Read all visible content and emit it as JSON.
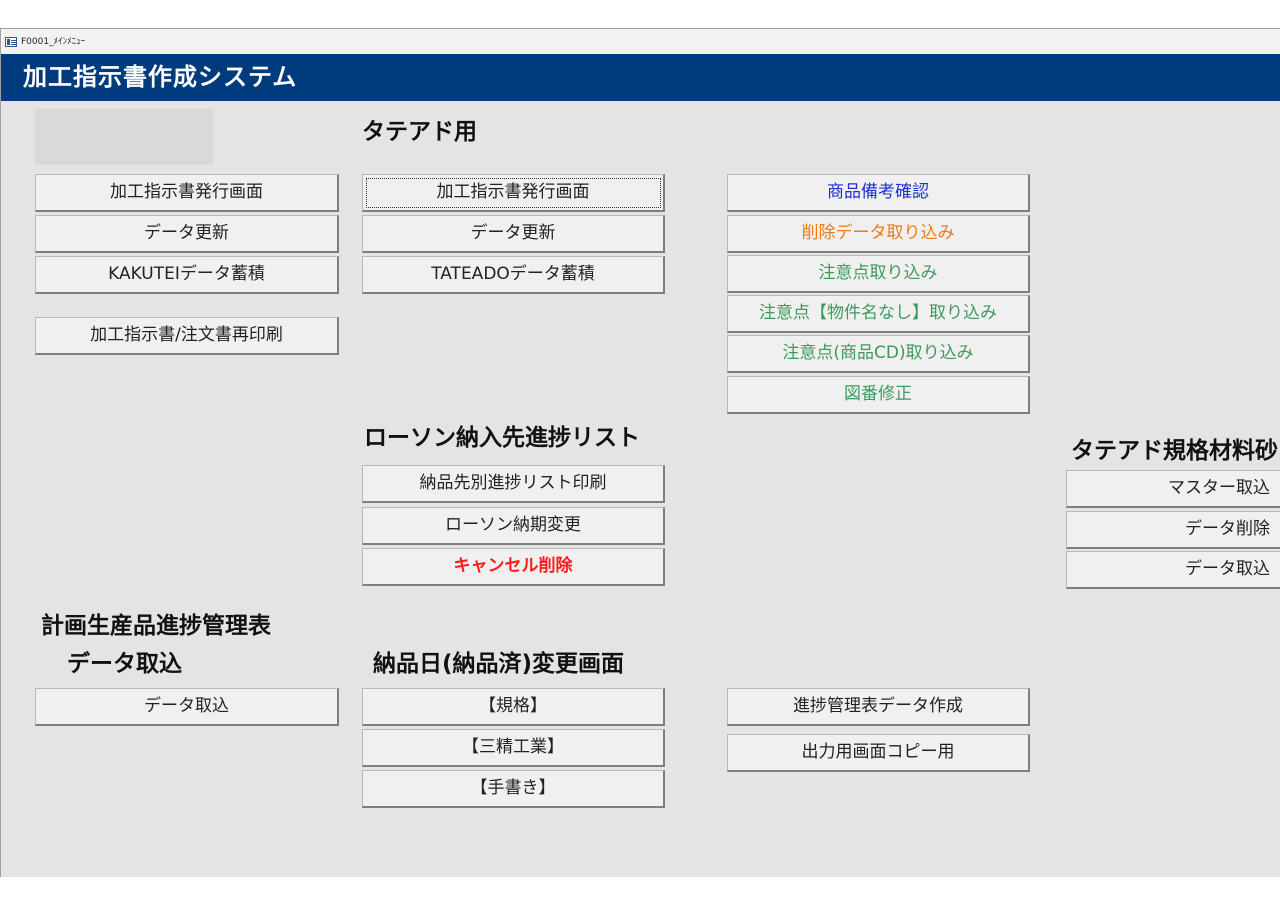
{
  "window": {
    "form_title": "F0001_ﾒｲﾝﾒﾆｭｰ",
    "icon": "form-icon"
  },
  "header": {
    "title": "加工指示書作成システム",
    "background": "#003b7d"
  },
  "section_general": {
    "buttons": [
      "加工指示書発行画面",
      "データ更新",
      "KAKUTEIデータ蓄積",
      "加工指示書/注文書再印刷"
    ]
  },
  "section_tateado": {
    "heading": "タテアド用",
    "buttons": [
      "加工指示書発行画面",
      "データ更新",
      "TATEADOデータ蓄積"
    ]
  },
  "section_imports": {
    "buttons": [
      "商品備考確認",
      "削除データ取り込み",
      "注意点取り込み",
      "注意点【物件名なし】取り込み",
      "注意点(商品CD)取り込み",
      "図番修正"
    ],
    "colors": {
      "blue": "#1d2fd0",
      "orange": "#ee7a14",
      "green": "#3d9a5e"
    }
  },
  "section_lawson": {
    "heading": "ローソン納入先進捗リスト",
    "buttons": [
      "納品先別進捗リスト印刷",
      "ローソン納期変更",
      "キャンセル削除"
    ],
    "danger_color": "#ff1a1a"
  },
  "section_tateado_materials": {
    "heading": "タテアド規格材料砂",
    "buttons": [
      "マスター取込",
      "データ削除",
      "データ取込"
    ]
  },
  "section_plan": {
    "heading_line1": "計画生産品進捗管理表",
    "heading_line2": "データ取込",
    "buttons": [
      "データ取込"
    ]
  },
  "section_delivery_date": {
    "heading": "納品日(納品済)変更画面",
    "buttons": [
      "【規格】",
      "【三精工業】",
      "【手書き】"
    ]
  },
  "section_progress": {
    "buttons": [
      "進捗管理表データ作成",
      "出力用画面コピー用"
    ]
  }
}
